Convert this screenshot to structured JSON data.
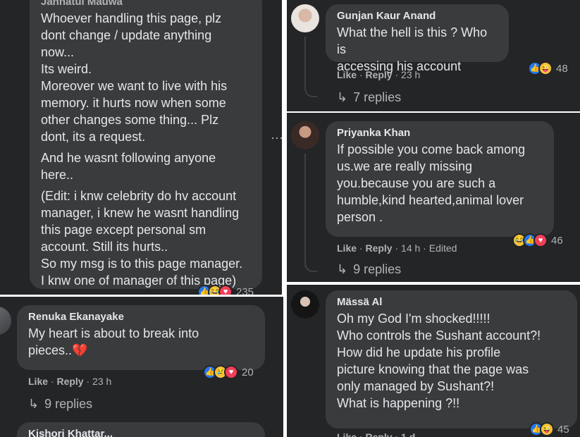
{
  "left_top": {
    "author_cut": "Jannatul Mauwa",
    "paragraphs": [
      [
        "Whoever handling this page, plz",
        "dont change / update anything",
        "now...",
        "Its weird.",
        "Moreover we want to live with his",
        "memory. it hurts now when some",
        "other changes some thing... Plz",
        "dont, its a request."
      ],
      [
        "And he wasnt following anyone",
        "here.."
      ],
      [
        "(Edit: i knw celebrity do hv account",
        "manager, i knew he wasnt handling",
        "this page except personal sm",
        "account. Still its hurts..",
        "So my msg is to this page manager.",
        "I knw one of manager of this page)"
      ]
    ],
    "reaction_count": "235",
    "more_icon": "ellipsis-icon"
  },
  "left_bottom": {
    "author": "Renuka Ekanayake",
    "lines": [
      "My heart is about to break into",
      "pieces..💔"
    ],
    "like": "Like",
    "reply": "Reply",
    "time": "23 h",
    "reaction_count": "20",
    "replies": "9 replies",
    "next_author_cut": "Kishori Khattar..."
  },
  "right_top": {
    "author": "Gunjan Kaur Anand",
    "lines": [
      "What the hell is this ? Who is",
      "accessing his account"
    ],
    "like": "Like",
    "reply": "Reply",
    "time": "23 h",
    "reaction_count": "48",
    "replies": "7 replies"
  },
  "right_mid": {
    "author": "Priyanka Khan",
    "lines": [
      "If possible you come back among",
      "us.we are really missing",
      "you.because you are such a",
      "humble,kind hearted,animal lover",
      "person ."
    ],
    "like": "Like",
    "reply": "Reply",
    "time": "14 h",
    "edited": "Edited",
    "reaction_count": "46",
    "replies": "9 replies"
  },
  "right_bottom": {
    "author": "Mässä Al",
    "lines": [
      "Oh my God I'm shocked!!!!!",
      "Who controls the Sushant account?!",
      "How did he update his profile",
      "picture knowing that the page was",
      "only managed by Sushant?!",
      "What is happening ?!!"
    ],
    "meta_cut": "Like · Reply · 1 d",
    "reaction_count": "45"
  },
  "separator": " · ",
  "reply_arrow": "↳"
}
